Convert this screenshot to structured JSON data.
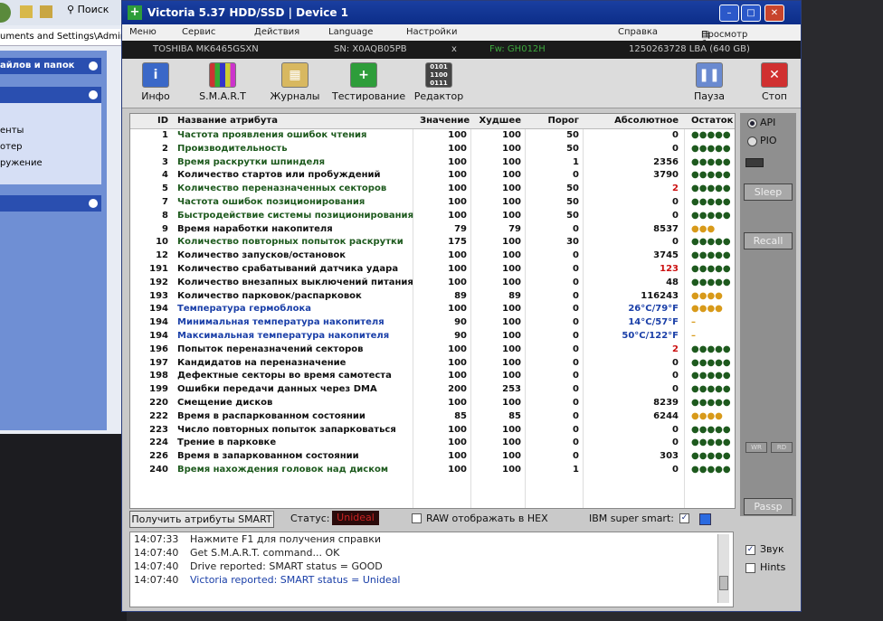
{
  "background_explorer": {
    "search_label": "Поиск",
    "address_text": "uments and Settings\\Admin\\Pa",
    "panel1_title": "айлов и папок",
    "panel_items": [
      "енты",
      "отер",
      "ружение"
    ]
  },
  "window": {
    "title": "Victoria 5.37 HDD/SSD | Device 1",
    "min_glyph": "–",
    "max_glyph": "□",
    "close_glyph": "✕"
  },
  "menu": {
    "items": [
      "Меню",
      "Сервис",
      "Действия",
      "Language",
      "Настройки"
    ],
    "help": "Справка",
    "clipboard": "Просмотр буфера"
  },
  "device": {
    "model": "TOSHIBA MK6465GSXN",
    "serial": "SN: X0AQB05PB",
    "x_mark": "x",
    "firmware": "Fw: GH012H",
    "lba": "1250263728 LBA (640 GB)"
  },
  "toolbar": {
    "info": "Инфо",
    "smart": "S.M.A.R.T",
    "logs": "Журналы",
    "test": "Тестирование",
    "editor": "Редактор",
    "pause": "Пауза",
    "stop": "Стоп"
  },
  "grid": {
    "headers": [
      "ID",
      "Название атрибута",
      "Значение",
      "Худшее",
      "Порог",
      "Абсолютное",
      "Остаток"
    ],
    "rows": [
      {
        "id": "1",
        "name": "Частота проявления ошибок чтения",
        "value": "100",
        "worst": "100",
        "thresh": "50",
        "raw": "0",
        "rem": "●●●●●",
        "nc": "#1e5a1e",
        "rc": "#111",
        "mc": "#1e5a1e"
      },
      {
        "id": "2",
        "name": "Производительность",
        "value": "100",
        "worst": "100",
        "thresh": "50",
        "raw": "0",
        "rem": "●●●●●",
        "nc": "#1e5a1e",
        "rc": "#111",
        "mc": "#1e5a1e"
      },
      {
        "id": "3",
        "name": "Время раскрутки шпинделя",
        "value": "100",
        "worst": "100",
        "thresh": "1",
        "raw": "2356",
        "rem": "●●●●●",
        "nc": "#1e5a1e",
        "rc": "#111",
        "mc": "#1e5a1e"
      },
      {
        "id": "4",
        "name": "Количество стартов или пробуждений",
        "value": "100",
        "worst": "100",
        "thresh": "0",
        "raw": "3790",
        "rem": "●●●●●",
        "nc": "#111",
        "rc": "#111",
        "mc": "#1e5a1e"
      },
      {
        "id": "5",
        "name": "Количество переназначенных секторов",
        "value": "100",
        "worst": "100",
        "thresh": "50",
        "raw": "2",
        "rem": "●●●●●",
        "nc": "#1e5a1e",
        "rc": "#cc1111",
        "mc": "#1e5a1e"
      },
      {
        "id": "7",
        "name": "Частота ошибок позиционирования",
        "value": "100",
        "worst": "100",
        "thresh": "50",
        "raw": "0",
        "rem": "●●●●●",
        "nc": "#1e5a1e",
        "rc": "#111",
        "mc": "#1e5a1e"
      },
      {
        "id": "8",
        "name": "Быстродействие системы позиционирования",
        "value": "100",
        "worst": "100",
        "thresh": "50",
        "raw": "0",
        "rem": "●●●●●",
        "nc": "#1e5a1e",
        "rc": "#111",
        "mc": "#1e5a1e"
      },
      {
        "id": "9",
        "name": "Время наработки накопителя",
        "value": "79",
        "worst": "79",
        "thresh": "0",
        "raw": "8537",
        "rem": "●●●",
        "nc": "#111",
        "rc": "#111",
        "mc": "#d89a1a"
      },
      {
        "id": "10",
        "name": "Количество повторных попыток раскрутки",
        "value": "175",
        "worst": "100",
        "thresh": "30",
        "raw": "0",
        "rem": "●●●●●",
        "nc": "#1e5a1e",
        "rc": "#111",
        "mc": "#1e5a1e"
      },
      {
        "id": "12",
        "name": "Количество запусков/остановок",
        "value": "100",
        "worst": "100",
        "thresh": "0",
        "raw": "3745",
        "rem": "●●●●●",
        "nc": "#111",
        "rc": "#111",
        "mc": "#1e5a1e"
      },
      {
        "id": "191",
        "name": "Количество срабатываний датчика удара",
        "value": "100",
        "worst": "100",
        "thresh": "0",
        "raw": "123",
        "rem": "●●●●●",
        "nc": "#111",
        "rc": "#cc1111",
        "mc": "#1e5a1e"
      },
      {
        "id": "192",
        "name": "Количество внезапных выключений питания",
        "value": "100",
        "worst": "100",
        "thresh": "0",
        "raw": "48",
        "rem": "●●●●●",
        "nc": "#111",
        "rc": "#111",
        "mc": "#1e5a1e"
      },
      {
        "id": "193",
        "name": "Количество парковок/распарковок",
        "value": "89",
        "worst": "89",
        "thresh": "0",
        "raw": "116243",
        "rem": "●●●●",
        "nc": "#111",
        "rc": "#111",
        "mc": "#d89a1a"
      },
      {
        "id": "194",
        "name": "Температура гермоблока",
        "value": "100",
        "worst": "100",
        "thresh": "0",
        "raw": "26°C/79°F",
        "rem": "●●●●",
        "nc": "#1a3fa8",
        "rc": "#1a3fa8",
        "mc": "#d89a1a"
      },
      {
        "id": "194",
        "name": "Минимальная температура накопителя",
        "value": "90",
        "worst": "100",
        "thresh": "0",
        "raw": "14°C/57°F",
        "rem": "–",
        "nc": "#1a3fa8",
        "rc": "#1a3fa8",
        "mc": "#d89a1a"
      },
      {
        "id": "194",
        "name": "Максимальная температура накопителя",
        "value": "90",
        "worst": "100",
        "thresh": "0",
        "raw": "50°C/122°F",
        "rem": "–",
        "nc": "#1a3fa8",
        "rc": "#1a3fa8",
        "mc": "#d89a1a"
      },
      {
        "id": "196",
        "name": "Попыток переназначений секторов",
        "value": "100",
        "worst": "100",
        "thresh": "0",
        "raw": "2",
        "rem": "●●●●●",
        "nc": "#111",
        "rc": "#cc1111",
        "mc": "#1e5a1e"
      },
      {
        "id": "197",
        "name": "Кандидатов на переназначение",
        "value": "100",
        "worst": "100",
        "thresh": "0",
        "raw": "0",
        "rem": "●●●●●",
        "nc": "#111",
        "rc": "#111",
        "mc": "#1e5a1e"
      },
      {
        "id": "198",
        "name": "Дефектные секторы во время самотеста",
        "value": "100",
        "worst": "100",
        "thresh": "0",
        "raw": "0",
        "rem": "●●●●●",
        "nc": "#111",
        "rc": "#111",
        "mc": "#1e5a1e"
      },
      {
        "id": "199",
        "name": "Ошибки передачи данных через DMA",
        "value": "200",
        "worst": "253",
        "thresh": "0",
        "raw": "0",
        "rem": "●●●●●",
        "nc": "#111",
        "rc": "#111",
        "mc": "#1e5a1e"
      },
      {
        "id": "220",
        "name": "Смещение дисков",
        "value": "100",
        "worst": "100",
        "thresh": "0",
        "raw": "8239",
        "rem": "●●●●●",
        "nc": "#111",
        "rc": "#111",
        "mc": "#1e5a1e"
      },
      {
        "id": "222",
        "name": "Время в распаркованном состоянии",
        "value": "85",
        "worst": "85",
        "thresh": "0",
        "raw": "6244",
        "rem": "●●●●",
        "nc": "#111",
        "rc": "#111",
        "mc": "#d89a1a"
      },
      {
        "id": "223",
        "name": "Число повторных попыток запарковаться",
        "value": "100",
        "worst": "100",
        "thresh": "0",
        "raw": "0",
        "rem": "●●●●●",
        "nc": "#111",
        "rc": "#111",
        "mc": "#1e5a1e"
      },
      {
        "id": "224",
        "name": "Трение в парковке",
        "value": "100",
        "worst": "100",
        "thresh": "0",
        "raw": "0",
        "rem": "●●●●●",
        "nc": "#111",
        "rc": "#111",
        "mc": "#1e5a1e"
      },
      {
        "id": "226",
        "name": "Время в запаркованном состоянии",
        "value": "100",
        "worst": "100",
        "thresh": "0",
        "raw": "303",
        "rem": "●●●●●",
        "nc": "#111",
        "rc": "#111",
        "mc": "#1e5a1e"
      },
      {
        "id": "240",
        "name": "Время нахождения головок над диском",
        "value": "100",
        "worst": "100",
        "thresh": "1",
        "raw": "0",
        "rem": "●●●●●",
        "nc": "#1e5a1e",
        "rc": "#111",
        "mc": "#1e5a1e"
      }
    ]
  },
  "bottom": {
    "get_button": "Получить атрибуты SMART",
    "status_label": "Статус:",
    "status_value": "Unideal",
    "raw_hex_label": "RAW отображать в HEX",
    "ibm_label": "IBM super smart:"
  },
  "log": [
    {
      "time": "14:07:33",
      "msg": "Нажмите F1 для получения справки",
      "color": "#222"
    },
    {
      "time": "14:07:40",
      "msg": "Get S.M.A.R.T. command... OK",
      "color": "#222"
    },
    {
      "time": "14:07:40",
      "msg": "Drive reported: SMART status = GOOD",
      "color": "#222"
    },
    {
      "time": "14:07:40",
      "msg": "Victoria reported: SMART status = Unideal",
      "color": "#1a3fa8"
    }
  ],
  "right_panel": {
    "api": "API",
    "pio": "PIO",
    "sleep": "Sleep",
    "recall": "Recall",
    "wr": "WR",
    "rd": "RD",
    "passp": "Passp",
    "sound": "Звук",
    "hints": "Hints"
  },
  "colors": {
    "ok": "#1e5a1e",
    "warn": "#d89a1a",
    "bad": "#cc1111",
    "temp": "#1a3fa8"
  }
}
